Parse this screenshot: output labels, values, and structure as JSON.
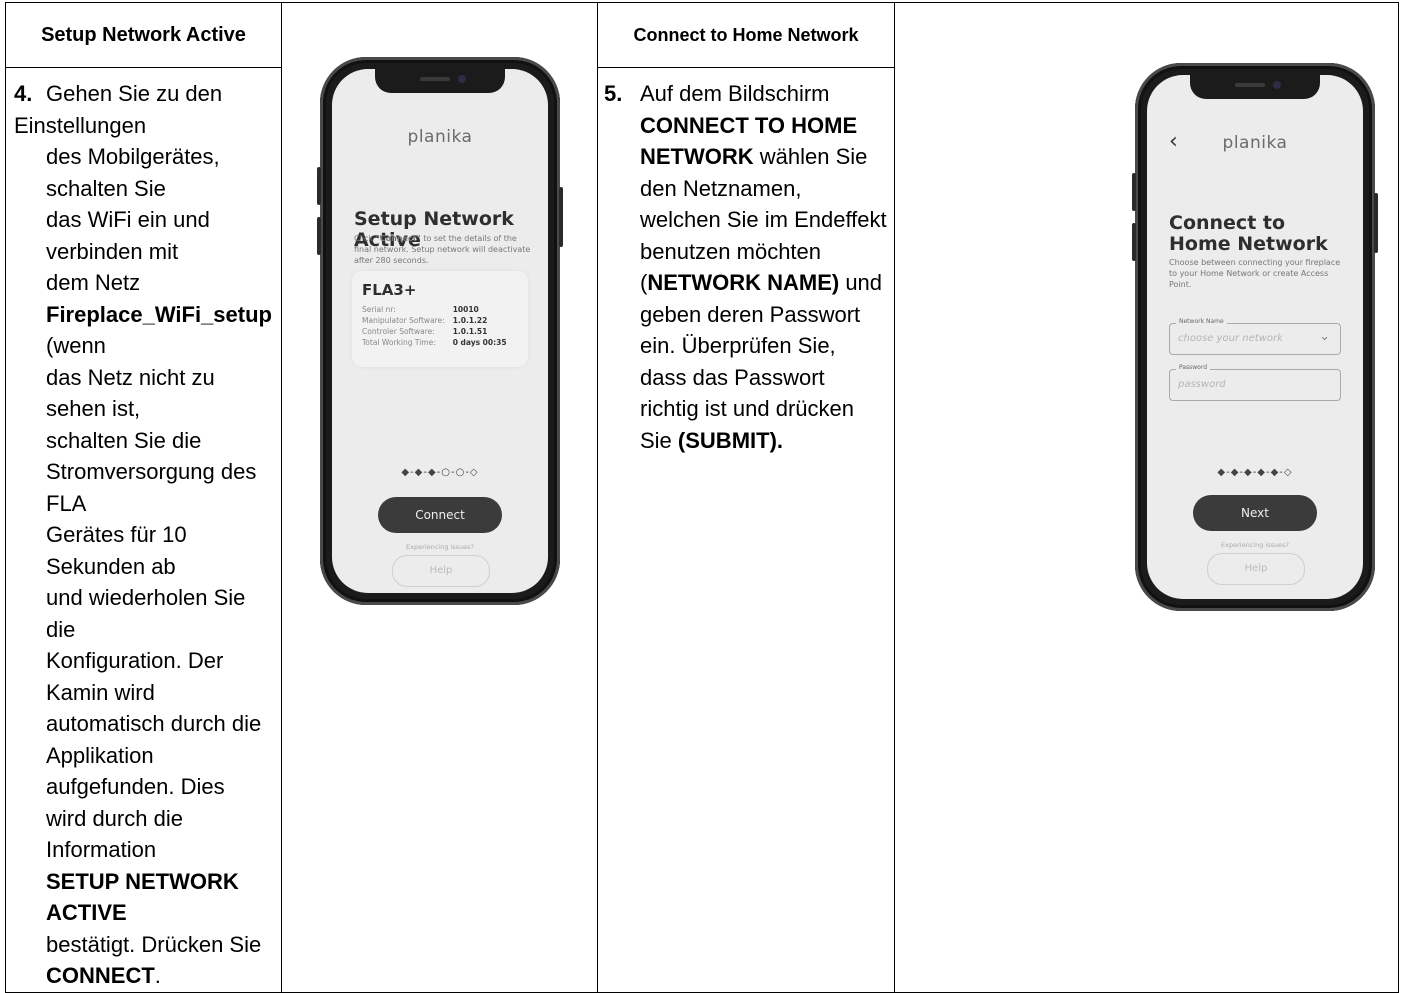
{
  "headers": {
    "col1": "Setup Network Active",
    "col3": "Connect to Home Network"
  },
  "step4": {
    "num": "4.",
    "lines": [
      "Gehen Sie zu den Einstellungen",
      "des Mobilgerätes, schalten Sie",
      "das WiFi ein und verbinden mit",
      "dem Netz",
      "Fireplace_WiFi_setup",
      " (wenn",
      "das Netz nicht zu sehen ist,",
      "schalten Sie die",
      "Stromversorgung des FLA",
      "Gerätes für 10 Sekunden ab",
      "und wiederholen Sie die",
      "Konfiguration. Der Kamin wird",
      "automatisch durch die",
      "Applikation aufgefunden. Dies",
      "wird durch die Information",
      "SETUP NETWORK ACTIVE",
      "bestätigt. Drücken Sie",
      "CONNECT",
      "."
    ]
  },
  "step5": {
    "num": "5.",
    "parts": [
      "Auf dem Bildschirm",
      "CONNECT TO HOME NETWORK",
      " wählen Sie den Netznamen, welchen Sie im Endeffekt benutzen möchten (",
      "NETWORK NAME)",
      " und geben deren Passwort ein. Überprüfen Sie, dass das Passwort richtig ist und drücken Sie ",
      "(SUBMIT)."
    ]
  },
  "phone1": {
    "brand": "planika",
    "title": "Setup Network Active",
    "desc_bold": "\"Connect\"",
    "desc_pre": "Click ",
    "desc_post": " to set the details of the final network. Setup network will deactivate after 280 seconds.",
    "device": "FLA3+",
    "rows": [
      {
        "k": "Serial nr:",
        "v": "10010"
      },
      {
        "k": "Manipulator Software:",
        "v": "1.0.1.22"
      },
      {
        "k": "Controler Software:",
        "v": "1.0.1.51"
      },
      {
        "k": "Total Working Time:",
        "v": "0 days 00:35"
      }
    ],
    "dots": "◆-◆-◆-○-○-◇",
    "button": "Connect",
    "issues": "Experiencing issues?",
    "help": "Help"
  },
  "phone2": {
    "back": "‹",
    "brand": "planika",
    "title_l1": "Connect to",
    "title_l2": "Home Network",
    "desc": "Choose between connecting your fireplace to your Home Network or create Access Point.",
    "network_label": "Network Name",
    "network_placeholder": "choose your network",
    "password_label": "Password",
    "password_placeholder": "password",
    "dots": "◆-◆-◆-◆-◆-◇",
    "button": "Next",
    "issues": "Experiencing issues?",
    "help": "Help"
  }
}
